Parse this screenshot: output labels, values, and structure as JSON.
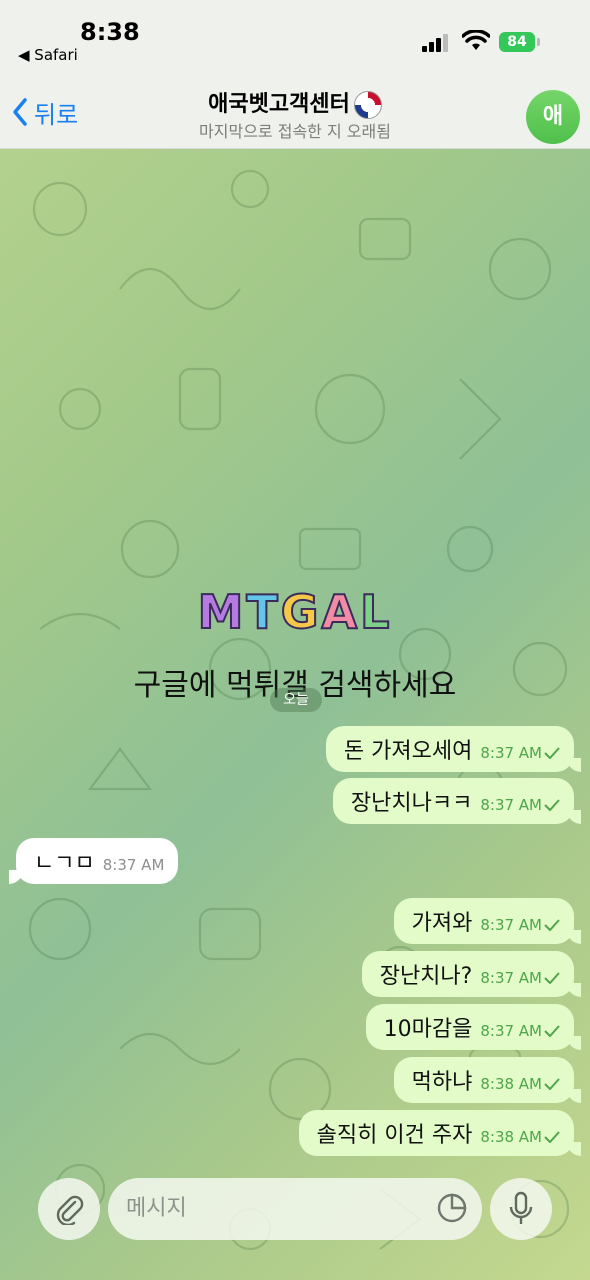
{
  "status_bar": {
    "time": "8:38",
    "back_app": "◀ Safari",
    "battery": "84"
  },
  "header": {
    "back_label": "뒤로",
    "title": "애국벳고객센터",
    "subtitle": "마지막으로 접속한 지 오래됨",
    "avatar_initial": "애"
  },
  "banner": {
    "logo": "MTGAL",
    "text": "구글에 먹튀갤 검색하세요"
  },
  "day_pill": "오늘",
  "messages": [
    {
      "dir": "out",
      "text": "돈 가져오세여",
      "time": "8:37 AM"
    },
    {
      "dir": "out",
      "text": "장난치나ㅋㅋ",
      "time": "8:37 AM"
    },
    {
      "dir": "in",
      "text": "ㄴㄱㅁ",
      "time": "8:37 AM"
    },
    {
      "dir": "out",
      "text": "가져와",
      "time": "8:37 AM"
    },
    {
      "dir": "out",
      "text": "장난치나?",
      "time": "8:37 AM"
    },
    {
      "dir": "out",
      "text": "10마감을",
      "time": "8:37 AM"
    },
    {
      "dir": "out",
      "text": "먹하냐",
      "time": "8:38 AM"
    },
    {
      "dir": "out",
      "text": "솔직히 이건 주자",
      "time": "8:38 AM"
    }
  ],
  "input": {
    "placeholder": "메시지"
  },
  "colors": {
    "accent": "#1a7ff0",
    "outgoing_bubble": "#e3fbc9",
    "incoming_bubble": "#ffffff",
    "time_green": "#4ea54b"
  }
}
